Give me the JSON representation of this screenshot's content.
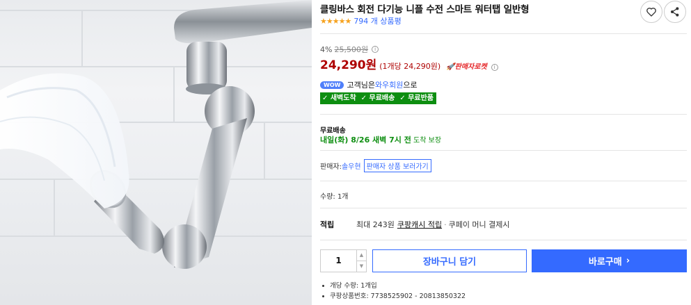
{
  "product": {
    "title": "클링바스 회전 다기능 니플 수전 스마트 워터탭 일반형",
    "stars": "★★★★★",
    "review_count": "794 개 상품평"
  },
  "price": {
    "discount_rate": "4%",
    "original_price": "25,500원",
    "sale_price": "24,290원",
    "unit_price": "(1개당 24,290원)",
    "rocket_badge": "🚀판매자로켓"
  },
  "wow": {
    "badge": "WOW",
    "prefix": "고객님은 ",
    "member_link": "와우회원",
    "suffix": "으로"
  },
  "benefits": [
    "✓ 새벽도착",
    "✓ 무료배송",
    "✓ 무료반품"
  ],
  "shipping": {
    "title": "무료배송",
    "eta": "내일(화) 8/26 새벽 7시 전",
    "guarantee": " 도착 보장"
  },
  "seller": {
    "label": "판매자: ",
    "name": "솔우현",
    "store_button": "판매자 상품 보러가기"
  },
  "quantity_label": "수량: 1개",
  "reward": {
    "label": "적립",
    "amount": "최대 243원",
    "link": "쿠팡캐시 적립",
    "separator": "·",
    "method": "쿠페이 머니 결제시"
  },
  "order": {
    "quantity": "1",
    "cart_button": "장바구니 담기",
    "buy_button": "바로구매",
    "buy_chevron": "›"
  },
  "notes": [
    "개당 수량: 1개입",
    "쿠팡상품번호: 7738525902 - 20813850322"
  ],
  "icons": {
    "heart": "♡",
    "share": "share-icon"
  },
  "colors": {
    "accent_blue": "#346aff",
    "price_red": "#ae0000",
    "green_badge": "#0d8e10",
    "star_orange": "#f6a21e"
  }
}
